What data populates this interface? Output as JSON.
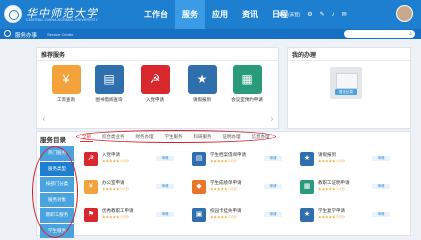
{
  "header": {
    "logo_title": "华中师范大学",
    "logo_subtitle": "CENTRAL CHINA NORMAL UNIVERSITY",
    "nav": [
      {
        "label": "工作台",
        "active": false
      },
      {
        "label": "服务",
        "active": true
      },
      {
        "label": "应用",
        "active": false
      },
      {
        "label": "资讯",
        "active": false
      },
      {
        "label": "日程",
        "active": false
      }
    ],
    "user_name": "黄志 (未登)"
  },
  "subheader": {
    "title": "服务办事",
    "title_en": "Service Center",
    "search_placeholder": ""
  },
  "recommended": {
    "title": "推荐服务",
    "items": [
      {
        "label": "工资查询",
        "color": "#f4a23b",
        "glyph": "¥"
      },
      {
        "label": "图书借阅查询",
        "color": "#2f6fae",
        "glyph": "▤"
      },
      {
        "label": "入党申请",
        "color": "#d8272d",
        "glyph": "☭"
      },
      {
        "label": "请假报到",
        "color": "#2f6fae",
        "glyph": "★"
      },
      {
        "label": "会议室预约申请",
        "color": "#2a9a7d",
        "glyph": "▦"
      }
    ]
  },
  "recent": {
    "title": "我的办理",
    "badge": "暂无记录"
  },
  "catalog": {
    "title": "服务目录",
    "tabs": [
      {
        "label": "全部",
        "active": true
      },
      {
        "label": "综合类业务",
        "active": false
      },
      {
        "label": "财务办理",
        "active": false
      },
      {
        "label": "学生服务",
        "active": false
      },
      {
        "label": "科研服务",
        "active": false
      },
      {
        "label": "证明办理",
        "active": false
      },
      {
        "label": "信息办理",
        "active": false
      }
    ],
    "side": [
      {
        "label": "热门服务",
        "active": false
      },
      {
        "label": "服务类型",
        "active": true
      },
      {
        "label": "按部门分类",
        "active": false
      },
      {
        "label": "服务对象",
        "active": false
      },
      {
        "label": "教职工服务",
        "active": false
      },
      {
        "label": "学生服务",
        "active": false
      }
    ],
    "cards": [
      {
        "title": "入党申请",
        "stars": "★★★★★ 0.0分",
        "button": "申请",
        "color": "#d8272d",
        "glyph": "☭"
      },
      {
        "title": "学生档案借阅申请",
        "stars": "★★★★★ 0.0分",
        "button": "申请",
        "color": "#2f6fae",
        "glyph": "▤"
      },
      {
        "title": "请假报到",
        "stars": "★★★★★ 0.0分",
        "button": "申请",
        "color": "#2f6fae",
        "glyph": "★"
      },
      {
        "title": "办公室申请",
        "stars": "★★★★★ 0.0分",
        "button": "申请",
        "color": "#f4a23b",
        "glyph": "¥"
      },
      {
        "title": "学生成绩单申请",
        "stars": "★★★★★ 0.0分",
        "button": "申请",
        "color": "#e8752a",
        "glyph": "◆"
      },
      {
        "title": "教职工证明申请",
        "stars": "★★★★★ 0.0分",
        "button": "申请",
        "color": "#2a9a7d",
        "glyph": "▦"
      },
      {
        "title": "优秀教职工申请",
        "stars": "★★★★★ 0.0分",
        "button": "申请",
        "color": "#d8272d",
        "glyph": "⚑"
      },
      {
        "title": "校园卡挂失申请",
        "stars": "★★★★★ 0.0分",
        "button": "申请",
        "color": "#2f6fae",
        "glyph": "▣"
      },
      {
        "title": "学生复学申请",
        "stars": "★★★★★ 0.0分",
        "button": "申请",
        "color": "#2f6fae",
        "glyph": "★"
      }
    ]
  }
}
